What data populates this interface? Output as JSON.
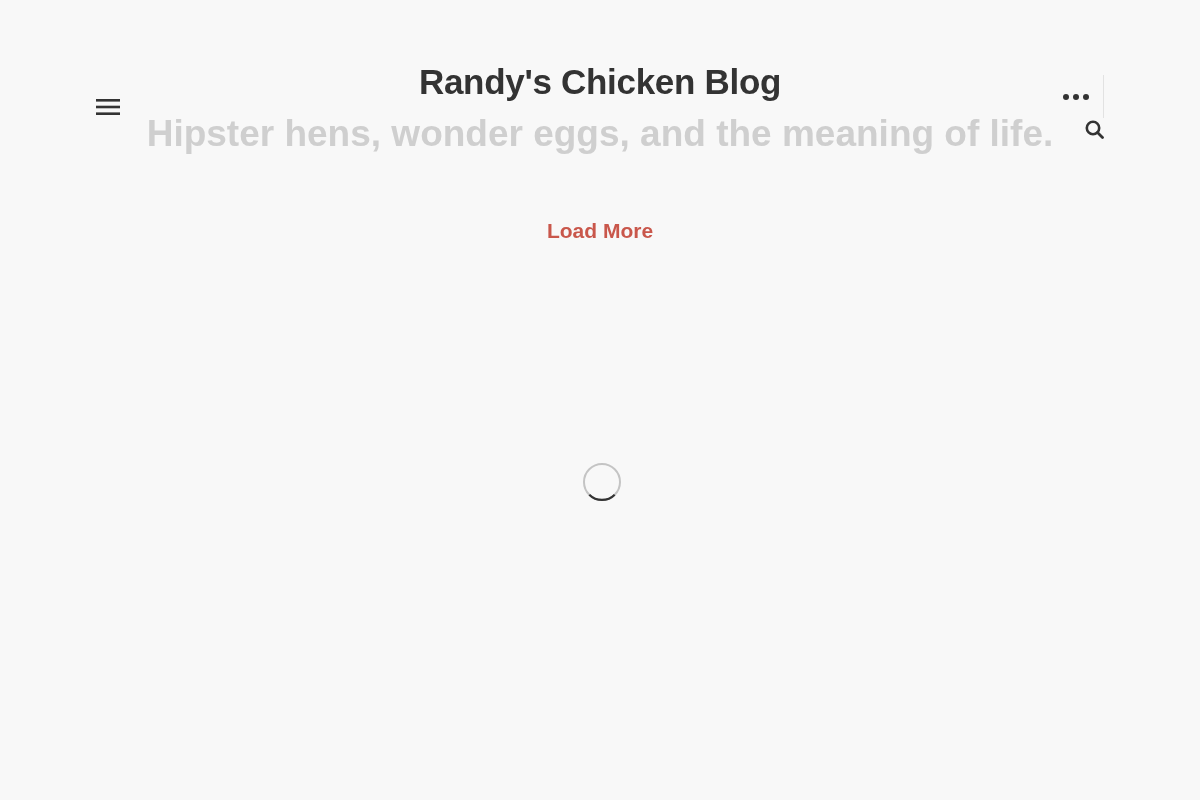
{
  "header": {
    "title": "Randy's Chicken Blog",
    "tagline": "Hipster hens, wonder eggs, and the meaning of life."
  },
  "feed": {
    "load_more": "Load More",
    "loading": true
  }
}
